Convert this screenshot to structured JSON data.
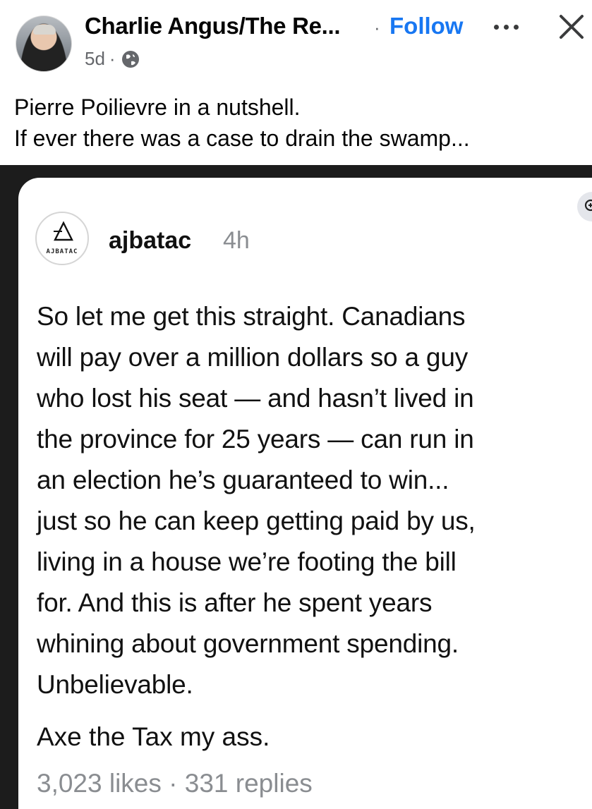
{
  "post": {
    "author": "Charlie Angus/The Re...",
    "separator": "·",
    "follow_label": "Follow",
    "time": "5d",
    "meta_separator": "·",
    "privacy_icon": "globe-icon",
    "caption_lines": [
      "Pierre Poilievre in a nutshell.",
      "If ever there was a case to drain the swamp..."
    ]
  },
  "embedded": {
    "logo_text": "AJBATAC",
    "handle": "ajbatac",
    "time": "4h",
    "body_lines": [
      "So let me get this straight. Canadians",
      "will pay over a million dollars so a guy",
      "who lost his seat — and hasn’t lived in",
      "the province for 25 years — can run in",
      "an election he’s guaranteed to win...",
      "just so he can keep getting paid by us,",
      "living in a house we’re footing the bill",
      "for. And this is after he spent years",
      "whining about government spending.",
      "Unbelievable."
    ],
    "closing": "Axe the Tax my ass.",
    "stats": "3,023 likes · 331 replies"
  },
  "colors": {
    "accent": "#1877f2",
    "muted": "#65676b",
    "image_bg": "#1c1c1c"
  }
}
